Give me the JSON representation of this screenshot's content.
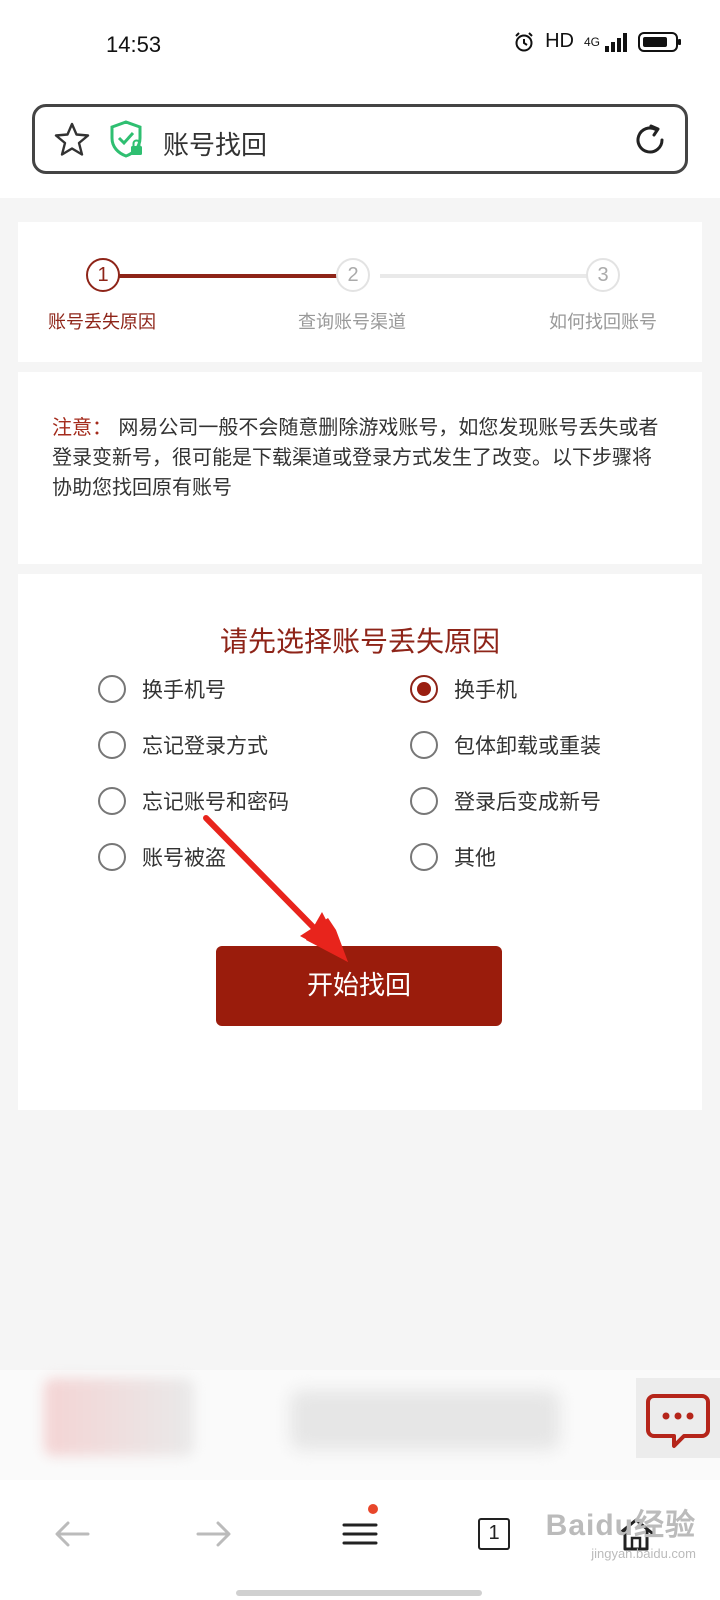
{
  "status_bar": {
    "time": "14:53",
    "hd_label": "HD",
    "network_label": "4G"
  },
  "address_bar": {
    "title": "账号找回"
  },
  "steps": [
    {
      "number": "1",
      "label": "账号丢失原因",
      "state": "active"
    },
    {
      "number": "2",
      "label": "查询账号渠道",
      "state": "inactive"
    },
    {
      "number": "3",
      "label": "如何找回账号",
      "state": "inactive"
    }
  ],
  "notice": {
    "lead": "注意：",
    "body": "网易公司一般不会随意删除游戏账号，如您发现账号丢失或者登录变新号，很可能是下载渠道或登录方式发生了改变。以下步骤将协助您找回原有账号"
  },
  "form": {
    "title": "请先选择账号丢失原因",
    "options": [
      {
        "label": "换手机号",
        "checked": false
      },
      {
        "label": "换手机",
        "checked": true
      },
      {
        "label": "忘记登录方式",
        "checked": false
      },
      {
        "label": "包体卸载或重装",
        "checked": false
      },
      {
        "label": "忘记账号和密码",
        "checked": false
      },
      {
        "label": "登录后变成新号",
        "checked": false
      },
      {
        "label": "账号被盗",
        "checked": false
      },
      {
        "label": "其他",
        "checked": false
      }
    ],
    "submit_label": "开始找回"
  },
  "bottom_nav": {
    "tab_count": "1"
  },
  "watermark": {
    "main": "Baidu经验",
    "sub": "jingyan.baidu.com"
  },
  "colors": {
    "brand": "#9a1c0c",
    "accent_text": "#8e2418",
    "annotation_arrow": "#e8241c"
  }
}
